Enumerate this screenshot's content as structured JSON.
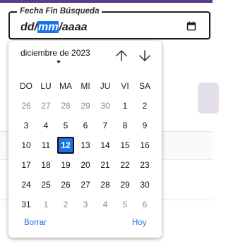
{
  "field": {
    "label": "Fecha Fin Búsqueda",
    "day_placeholder": "dd",
    "month_placeholder": "mm",
    "year_placeholder": "aaaa",
    "separator": "/",
    "icon": "calendar-icon"
  },
  "calendar": {
    "month_label": "diciembre de 2023",
    "weekdays": [
      "DO",
      "LU",
      "MA",
      "MI",
      "JU",
      "VI",
      "SA"
    ],
    "weeks": [
      [
        {
          "d": "26",
          "out": true
        },
        {
          "d": "27",
          "out": true
        },
        {
          "d": "28",
          "out": true
        },
        {
          "d": "29",
          "out": true
        },
        {
          "d": "30",
          "out": true
        },
        {
          "d": "1"
        },
        {
          "d": "2"
        }
      ],
      [
        {
          "d": "3"
        },
        {
          "d": "4"
        },
        {
          "d": "5"
        },
        {
          "d": "6"
        },
        {
          "d": "7"
        },
        {
          "d": "8"
        },
        {
          "d": "9"
        }
      ],
      [
        {
          "d": "10"
        },
        {
          "d": "11"
        },
        {
          "d": "12",
          "selected": true
        },
        {
          "d": "13"
        },
        {
          "d": "14"
        },
        {
          "d": "15"
        },
        {
          "d": "16"
        }
      ],
      [
        {
          "d": "17"
        },
        {
          "d": "18"
        },
        {
          "d": "19"
        },
        {
          "d": "20"
        },
        {
          "d": "21"
        },
        {
          "d": "22"
        },
        {
          "d": "23"
        }
      ],
      [
        {
          "d": "24"
        },
        {
          "d": "25"
        },
        {
          "d": "26"
        },
        {
          "d": "27"
        },
        {
          "d": "28"
        },
        {
          "d": "29"
        },
        {
          "d": "30"
        }
      ],
      [
        {
          "d": "31"
        },
        {
          "d": "1",
          "out": true
        },
        {
          "d": "2",
          "out": true
        },
        {
          "d": "3",
          "out": true
        },
        {
          "d": "4",
          "out": true
        },
        {
          "d": "5",
          "out": true
        },
        {
          "d": "6",
          "out": true
        }
      ]
    ],
    "clear_label": "Borrar",
    "today_label": "Hoy",
    "prev_icon": "arrow-up-icon",
    "next_icon": "arrow-down-icon"
  },
  "colors": {
    "accent": "#1a73e8",
    "topbar": "#5b3d82"
  }
}
